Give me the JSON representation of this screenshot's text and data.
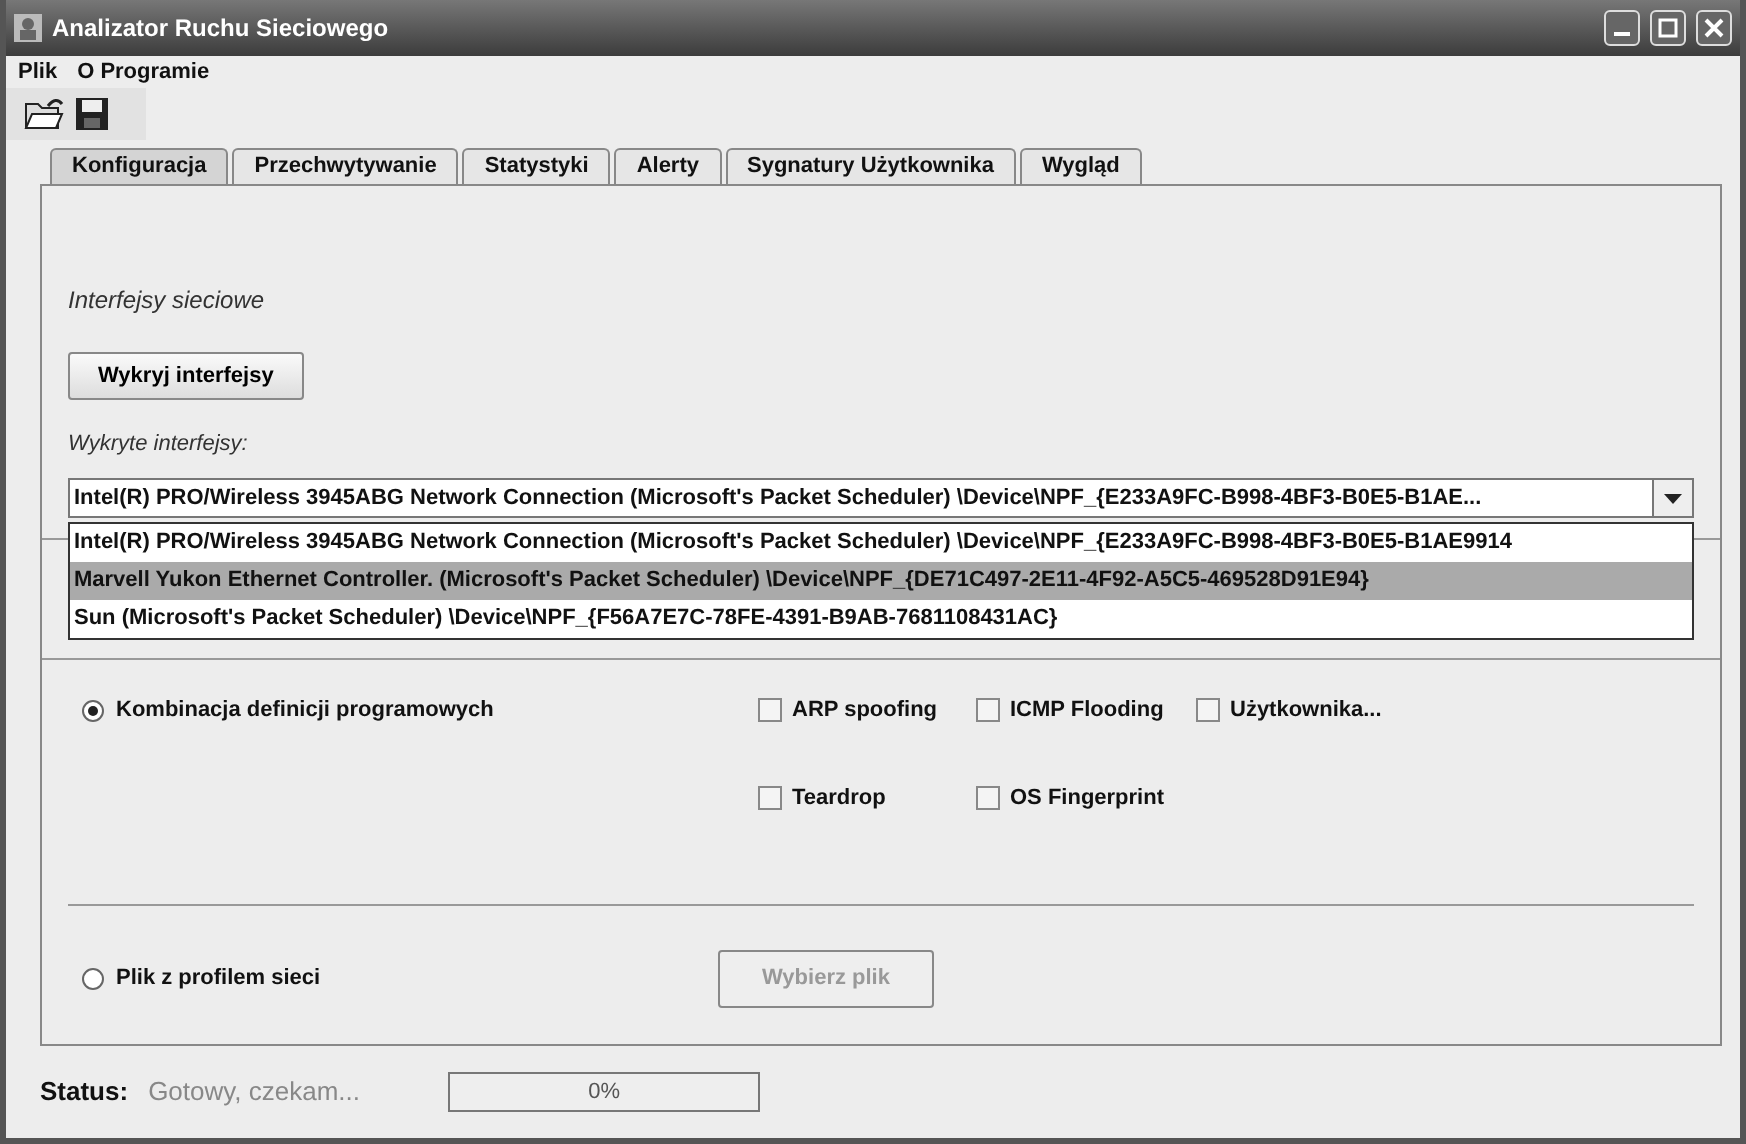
{
  "window": {
    "title": "Analizator Ruchu Sieciowego"
  },
  "menu": [
    {
      "label": "Plik"
    },
    {
      "label": "O Programie"
    }
  ],
  "tabs": [
    {
      "label": "Konfiguracja",
      "selected": true
    },
    {
      "label": "Przechwytywanie",
      "selected": false
    },
    {
      "label": "Statystyki",
      "selected": false
    },
    {
      "label": "Alerty",
      "selected": false
    },
    {
      "label": "Sygnatury Użytkownika",
      "selected": false
    },
    {
      "label": "Wygląd",
      "selected": false
    }
  ],
  "config": {
    "section_title": "Interfejsy sieciowe",
    "detect_button": "Wykryj interfejsy",
    "detected_label": "Wykryte interfejsy:",
    "combo": {
      "value": "Intel(R) PRO/Wireless 3945ABG Network Connection (Microsoft's Packet Scheduler)  \\Device\\NPF_{E233A9FC-B998-4BF3-B0E5-B1AE...",
      "expanded": true
    },
    "options": [
      {
        "label": "Intel(R) PRO/Wireless 3945ABG Network Connection (Microsoft's Packet Scheduler)  \\Device\\NPF_{E233A9FC-B998-4BF3-B0E5-B1AE9914",
        "selected": false
      },
      {
        "label": "Marvell Yukon Ethernet Controller. (Microsoft's Packet Scheduler)  \\Device\\NPF_{DE71C497-2E11-4F92-A5C5-469528D91E94}",
        "selected": true
      },
      {
        "label": "Sun (Microsoft's Packet Scheduler)  \\Device\\NPF_{F56A7E7C-78FE-4391-B9AB-7681108431AC}",
        "selected": false
      }
    ],
    "mode_definitions": {
      "label": "Kombinacja definicji programowych",
      "selected": true
    },
    "checkboxes": [
      {
        "label": "ARP spoofing",
        "checked": false
      },
      {
        "label": "ICMP Flooding",
        "checked": false
      },
      {
        "label": "Użytkownika...",
        "checked": false
      },
      {
        "label": "Teardrop",
        "checked": false
      },
      {
        "label": "OS Fingerprint",
        "checked": false
      }
    ],
    "mode_file": {
      "label": "Plik z profilem sieci",
      "selected": false
    },
    "file_button": {
      "label": "Wybierz plik",
      "disabled": true
    }
  },
  "status": {
    "label": "Status:",
    "text": "Gotowy, czekam...",
    "progress": {
      "level": 0,
      "text": "0%"
    }
  }
}
